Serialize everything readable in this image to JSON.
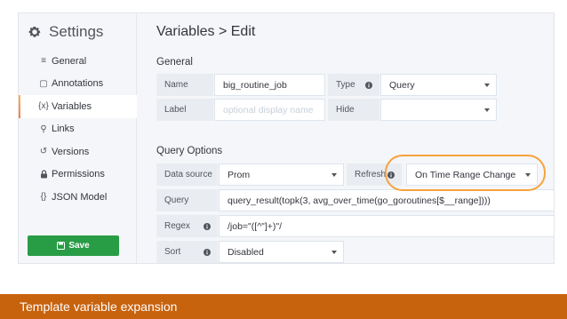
{
  "sidebar": {
    "title": "Settings",
    "items": [
      {
        "label": "General",
        "icon": "sliders-icon"
      },
      {
        "label": "Annotations",
        "icon": "comment-icon"
      },
      {
        "label": "Variables",
        "icon": "variable-icon",
        "active": true
      },
      {
        "label": "Links",
        "icon": "link-icon"
      },
      {
        "label": "Versions",
        "icon": "history-icon"
      },
      {
        "label": "Permissions",
        "icon": "lock-icon"
      },
      {
        "label": "JSON Model",
        "icon": "json-icon"
      }
    ],
    "icon_glyphs": [
      "≡",
      "▢",
      "{x}",
      "⚲",
      "↺",
      "🔒",
      "{}"
    ],
    "save_label": "Save"
  },
  "main": {
    "title": "Variables > Edit",
    "general": {
      "heading": "General",
      "name_label": "Name",
      "name_value": "big_routine_job",
      "type_label": "Type",
      "type_value": "Query",
      "label_label": "Label",
      "label_placeholder": "optional display name",
      "hide_label": "Hide",
      "hide_value": ""
    },
    "query_options": {
      "heading": "Query Options",
      "datasource_label": "Data source",
      "datasource_value": "Prom",
      "refresh_label": "Refresh",
      "refresh_value": "On Time Range Change",
      "query_label": "Query",
      "query_value": "query_result(topk(3, avg_over_time(go_goroutines[$__range])))",
      "regex_label": "Regex",
      "regex_value": "/job=\"([^\"]+)\"/",
      "sort_label": "Sort",
      "sort_value": "Disabled"
    }
  },
  "caption": "Template variable expansion",
  "colors": {
    "accent_orange": "#f6a23c",
    "save_green": "#299c46",
    "caption_bg": "#c7620d"
  }
}
